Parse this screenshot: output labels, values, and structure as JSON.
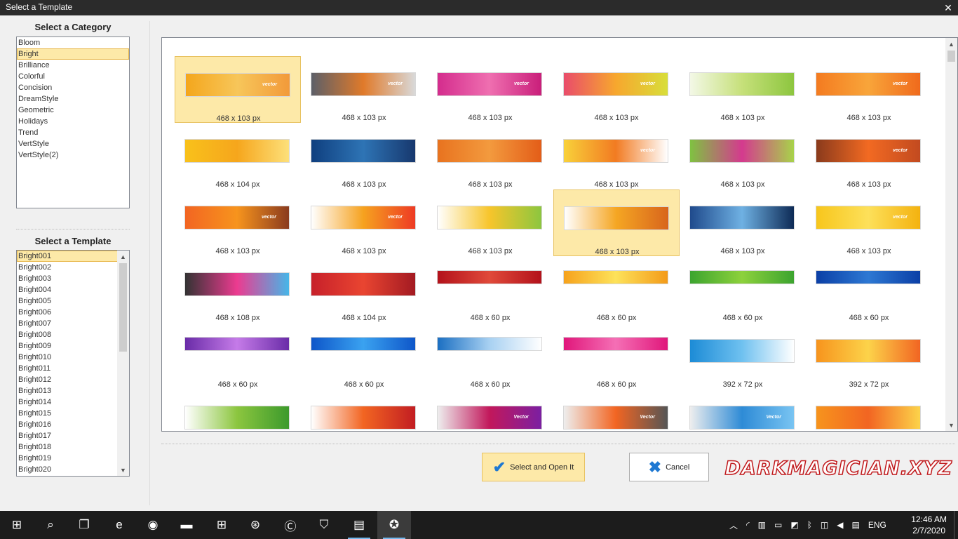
{
  "window": {
    "title": "Select a Template",
    "close_glyph": "✕"
  },
  "category_panel": {
    "heading": "Select a Category",
    "items": [
      "Bloom",
      "Bright",
      "Brilliance",
      "Colorful",
      "Concision",
      "DreamStyle",
      "Geometric",
      "Holidays",
      "Trend",
      "VertStyle",
      "VertStyle(2)"
    ],
    "selected": "Bright"
  },
  "template_panel": {
    "heading": "Select a Template",
    "items": [
      "Bright001",
      "Bright002",
      "Bright003",
      "Bright004",
      "Bright005",
      "Bright006",
      "Bright007",
      "Bright008",
      "Bright009",
      "Bright010",
      "Bright011",
      "Bright012",
      "Bright013",
      "Bright014",
      "Bright015",
      "Bright016",
      "Bright017",
      "Bright018",
      "Bright019",
      "Bright020"
    ],
    "selected": "Bright001"
  },
  "gallery": {
    "tiles": [
      {
        "label": "468 x 103 px",
        "colors": [
          "#f4a61c",
          "#f7c65a",
          "#f29a3a"
        ],
        "tag": "vector",
        "selected": true
      },
      {
        "label": "468 x 103 px",
        "colors": [
          "#5c5f68",
          "#e07a2a",
          "#d9d9d9"
        ],
        "tag": "vector",
        "selected": false
      },
      {
        "label": "468 x 103 px",
        "colors": [
          "#d42c8d",
          "#ef6fb0",
          "#c91e7a"
        ],
        "tag": "vector",
        "selected": false
      },
      {
        "label": "468 x 103 px",
        "colors": [
          "#e94c6b",
          "#f7a72e",
          "#d8de3a"
        ],
        "tag": "vector",
        "selected": false
      },
      {
        "label": "468 x 103 px",
        "colors": [
          "#f3f8e6",
          "#c6e07a",
          "#8dc63f"
        ],
        "tag": "",
        "selected": false
      },
      {
        "label": "468 x 103 px",
        "colors": [
          "#f47b20",
          "#f8a53a",
          "#f06a1c"
        ],
        "tag": "vector",
        "selected": false
      },
      {
        "label": "468 x 104 px",
        "colors": [
          "#f8c11b",
          "#f6a61c",
          "#fde07a"
        ],
        "tag": "",
        "selected": false
      },
      {
        "label": "468 x 103 px",
        "colors": [
          "#0f3f7f",
          "#2e74b5",
          "#17386e"
        ],
        "tag": "",
        "selected": false
      },
      {
        "label": "468 x 103 px",
        "colors": [
          "#e8731f",
          "#f39a3e",
          "#e35d18"
        ],
        "tag": "",
        "selected": false
      },
      {
        "label": "468 x 103 px",
        "colors": [
          "#f8d13a",
          "#f27b22",
          "#ffffff"
        ],
        "tag": "vector",
        "selected": false
      },
      {
        "label": "468 x 103 px",
        "colors": [
          "#7fc241",
          "#d43a8e",
          "#a8d34a"
        ],
        "tag": "",
        "selected": false
      },
      {
        "label": "468 x 103 px",
        "colors": [
          "#8a3a1c",
          "#f26a22",
          "#c24a20"
        ],
        "tag": "vector",
        "selected": false
      },
      {
        "label": "468 x 103 px",
        "colors": [
          "#f26522",
          "#f7941d",
          "#8a3b1e"
        ],
        "tag": "vector",
        "selected": false
      },
      {
        "label": "468 x 103 px",
        "colors": [
          "#ffffff",
          "#f6a21f",
          "#ee3b24"
        ],
        "tag": "vector",
        "selected": false
      },
      {
        "label": "468 x 103 px",
        "colors": [
          "#ffffff",
          "#f7c52b",
          "#8cc63f"
        ],
        "tag": "",
        "selected": false
      },
      {
        "label": "468 x 103 px",
        "colors": [
          "#ffffff",
          "#f5a623",
          "#d8651c"
        ],
        "tag": "",
        "selected": true
      },
      {
        "label": "468 x 103 px",
        "colors": [
          "#1f4a8c",
          "#6fb1e3",
          "#0d2a55"
        ],
        "tag": "",
        "selected": false
      },
      {
        "label": "468 x 103 px",
        "colors": [
          "#f7c61c",
          "#fde05a",
          "#f4b20f"
        ],
        "tag": "vector",
        "selected": false
      },
      {
        "label": "468 x 108 px",
        "colors": [
          "#333333",
          "#ec3b90",
          "#46b6e8"
        ],
        "tag": "",
        "selected": false
      },
      {
        "label": "468 x 104 px",
        "colors": [
          "#c7202a",
          "#e94531",
          "#a31a22"
        ],
        "tag": "",
        "selected": false
      },
      {
        "label": "468 x 60 px",
        "colors": [
          "#b3121b",
          "#e04a3a",
          "#b3121b"
        ],
        "tag": "",
        "selected": false,
        "thin": true
      },
      {
        "label": "468 x 60 px",
        "colors": [
          "#f6a21c",
          "#fde25a",
          "#f39b1a"
        ],
        "tag": "",
        "selected": false,
        "thin": true
      },
      {
        "label": "468 x 60 px",
        "colors": [
          "#3ca42f",
          "#8dd13c",
          "#3ca42f"
        ],
        "tag": "",
        "selected": false,
        "thin": true
      },
      {
        "label": "468 x 60 px",
        "colors": [
          "#0b3fa6",
          "#2d78d3",
          "#0b3fa6"
        ],
        "tag": "",
        "selected": false,
        "thin": true
      },
      {
        "label": "468 x 60 px",
        "colors": [
          "#6a2ca8",
          "#c57be8",
          "#6a2ca8"
        ],
        "tag": "",
        "selected": false,
        "thin": true
      },
      {
        "label": "468 x 60 px",
        "colors": [
          "#0e56c9",
          "#3aa2f0",
          "#0e56c9"
        ],
        "tag": "",
        "selected": false,
        "thin": true
      },
      {
        "label": "468 x 60 px",
        "colors": [
          "#1b6fc2",
          "#a8d1f2",
          "#ffffff"
        ],
        "tag": "",
        "selected": false,
        "thin": true
      },
      {
        "label": "468 x 60 px",
        "colors": [
          "#e0177b",
          "#f56fb5",
          "#e0177b"
        ],
        "tag": "",
        "selected": false,
        "thin": true
      },
      {
        "label": "392 x 72 px",
        "colors": [
          "#1c8bd6",
          "#6fc1f0",
          "#ffffff"
        ],
        "tag": "",
        "selected": false
      },
      {
        "label": "392 x 72 px",
        "colors": [
          "#f7941d",
          "#fcd34a",
          "#f26522"
        ],
        "tag": "",
        "selected": false
      },
      {
        "label": "",
        "colors": [
          "#ffffff",
          "#8cc63f",
          "#3c9a2c"
        ],
        "tag": "",
        "selected": false
      },
      {
        "label": "",
        "colors": [
          "#ffffff",
          "#f26522",
          "#c21d22"
        ],
        "tag": "",
        "selected": false
      },
      {
        "label": "",
        "colors": [
          "#eeeeee",
          "#c2185b",
          "#7b1fa2"
        ],
        "tag": "Vector",
        "selected": false
      },
      {
        "label": "",
        "colors": [
          "#eeeeee",
          "#f26522",
          "#555555"
        ],
        "tag": "Vector",
        "selected": false
      },
      {
        "label": "",
        "colors": [
          "#eeeeee",
          "#2e8bd6",
          "#79c4f2"
        ],
        "tag": "Vector",
        "selected": false
      },
      {
        "label": "",
        "colors": [
          "#f7941d",
          "#f26522",
          "#fcd34a"
        ],
        "tag": "",
        "selected": false
      }
    ]
  },
  "buttons": {
    "select_open": "Select and Open It",
    "select_open_icon": "✔",
    "cancel": "Cancel",
    "cancel_icon": "✖"
  },
  "watermark": "DARKMAGICIAN.XYZ",
  "taskbar": {
    "apps": [
      {
        "name": "windows-start-icon",
        "glyph": "⊞"
      },
      {
        "name": "search-icon",
        "glyph": "⌕"
      },
      {
        "name": "task-view-icon",
        "glyph": "❐"
      },
      {
        "name": "edge-browser-icon",
        "glyph": "e"
      },
      {
        "name": "chrome-browser-icon",
        "glyph": "◉"
      },
      {
        "name": "file-explorer-icon",
        "glyph": "▬"
      },
      {
        "name": "store-icon",
        "glyph": "⊞"
      },
      {
        "name": "media-app-icon",
        "glyph": "⊛"
      },
      {
        "name": "ccleaner-icon",
        "glyph": "Ⓒ"
      },
      {
        "name": "antivirus-icon",
        "glyph": "⛉"
      },
      {
        "name": "notepad-icon",
        "glyph": "▤"
      },
      {
        "name": "banner-maker-icon",
        "glyph": "✪"
      }
    ],
    "language": "ENG",
    "time": "12:46 AM",
    "date": "2/7/2020"
  }
}
